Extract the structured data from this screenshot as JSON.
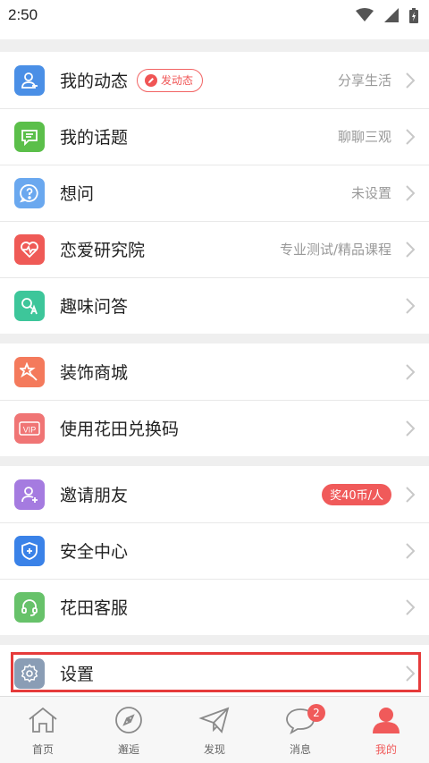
{
  "status_bar": {
    "time": "2:50"
  },
  "groups": [
    [
      {
        "name": "my-moments",
        "label": "我的动态",
        "icon": "person-icon",
        "color": "#4a8fe6",
        "sub": "分享生活",
        "pill": "发动态"
      },
      {
        "name": "my-topics",
        "label": "我的话题",
        "icon": "chat-icon",
        "color": "#5bbf4a",
        "sub": "聊聊三观"
      },
      {
        "name": "want-ask",
        "label": "想问",
        "icon": "question-icon",
        "color": "#6aa8ef",
        "sub": "未设置"
      },
      {
        "name": "love-institute",
        "label": "恋爱研究院",
        "icon": "heart-pulse-icon",
        "color": "#ef5a56",
        "sub": "专业测试/精品课程"
      },
      {
        "name": "fun-qa",
        "label": "趣味问答",
        "icon": "qa-icon",
        "color": "#3dc69a",
        "sub": ""
      }
    ],
    [
      {
        "name": "decor-shop",
        "label": "装饰商城",
        "icon": "star-wand-icon",
        "color": "#f47a5c",
        "sub": ""
      },
      {
        "name": "redeem-code",
        "label": "使用花田兑换码",
        "icon": "vip-icon",
        "color": "#f07575",
        "sub": ""
      }
    ],
    [
      {
        "name": "invite-friends",
        "label": "邀请朋友",
        "icon": "add-person-icon",
        "color": "#a57be0",
        "sub": "",
        "badge": "奖40币/人"
      },
      {
        "name": "security-center",
        "label": "安全中心",
        "icon": "shield-icon",
        "color": "#3a82e8",
        "sub": ""
      },
      {
        "name": "customer-service",
        "label": "花田客服",
        "icon": "headset-icon",
        "color": "#67c26a",
        "sub": ""
      }
    ],
    [
      {
        "name": "settings",
        "label": "设置",
        "icon": "gear-icon",
        "color": "#8a9db5",
        "sub": ""
      }
    ]
  ],
  "tabbar": [
    {
      "name": "home",
      "label": "首页",
      "icon": "home-icon"
    },
    {
      "name": "encounter",
      "label": "邂逅",
      "icon": "compass-icon"
    },
    {
      "name": "discover",
      "label": "发现",
      "icon": "paper-plane-icon"
    },
    {
      "name": "messages",
      "label": "消息",
      "icon": "chat-bubble-icon",
      "badge": "2"
    },
    {
      "name": "me",
      "label": "我的",
      "icon": "user-icon",
      "active": true
    }
  ]
}
